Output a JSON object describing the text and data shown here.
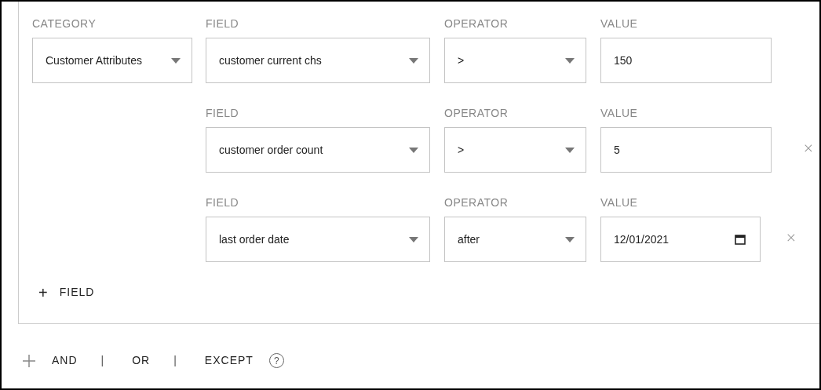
{
  "category": {
    "label": "CATEGORY",
    "value": "Customer Attributes"
  },
  "conditions": [
    {
      "field_label": "FIELD",
      "field": "customer current chs",
      "operator_label": "OPERATOR",
      "operator": ">",
      "value_label": "VALUE",
      "value": "150",
      "kind": "text",
      "removable": false
    },
    {
      "field_label": "FIELD",
      "field": "customer order count",
      "operator_label": "OPERATOR",
      "operator": ">",
      "value_label": "VALUE",
      "value": "5",
      "kind": "text",
      "removable": true
    },
    {
      "field_label": "FIELD",
      "field": "last order date",
      "operator_label": "OPERATOR",
      "operator": "after",
      "value_label": "VALUE",
      "value": "12/01/2021",
      "kind": "date",
      "removable": true
    }
  ],
  "add_field": {
    "icon": "+",
    "label": "FIELD"
  },
  "combinators": [
    {
      "label": "AND"
    },
    {
      "label": "|"
    },
    {
      "label": "OR"
    },
    {
      "label": "|"
    },
    {
      "label": "EXCEPT"
    }
  ],
  "help": "?"
}
